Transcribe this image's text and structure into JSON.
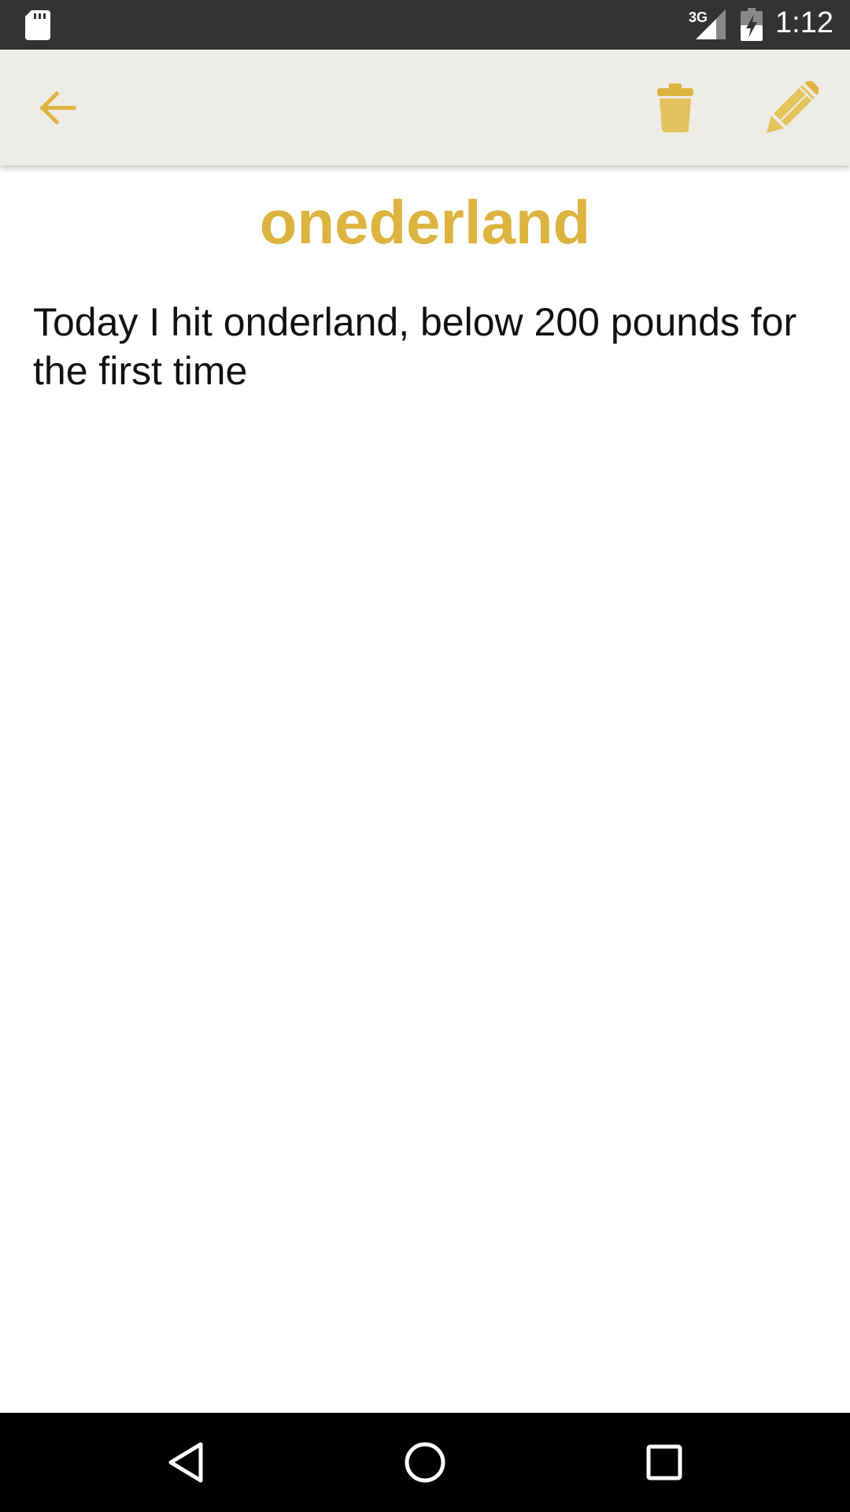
{
  "status_bar": {
    "network": "3G",
    "time": "1:12",
    "icons": [
      "sd-card-icon",
      "signal-icon",
      "battery-charging-icon"
    ]
  },
  "toolbar": {
    "icons": [
      "back-arrow-icon",
      "trash-icon",
      "pencil-icon"
    ],
    "accent_color": "#dcb43f"
  },
  "note": {
    "title": "onederland",
    "body": "Today I hit onderland, below 200 pounds for the first time"
  },
  "nav_bar": {
    "icons": [
      "nav-back-icon",
      "nav-home-icon",
      "nav-recents-icon"
    ]
  }
}
